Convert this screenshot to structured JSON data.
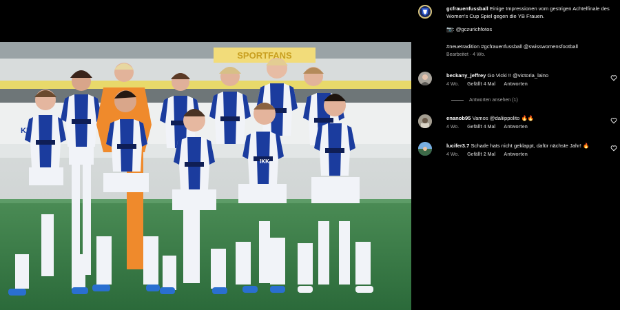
{
  "post": {
    "author": "gcfrauenfussball",
    "caption": "Einige Impressionen vom gestrigen Achtelfinale des Women's Cup Spiel gegen die YB Frauen.",
    "photo_credit_emoji": "📷",
    "photo_credit": ": @gczurichfotos",
    "hashtags": "#neuetradition #gcfrauenfussball @swisswomensfootball",
    "edited_label": "Bearbeitet · 4 Wo.",
    "photo_text": {
      "stadium_banner": "SPORTFANS",
      "jersey_sponsor": "IKK",
      "left_board": "KPMG"
    }
  },
  "comments": [
    {
      "user": "beckany_jeffrey",
      "text": "Go Vicki !! @victoria_laino",
      "age": "4 Wo.",
      "likes": "Gefällt 4 Mal",
      "reply": "Antworten",
      "view_replies": "Antworten ansehen (1)"
    },
    {
      "user": "enanob95",
      "text": "Vamos @daliippolito 🔥🔥",
      "age": "4 Wo.",
      "likes": "Gefällt 4 Mal",
      "reply": "Antworten"
    },
    {
      "user": "lucifer3.7",
      "text": "Schade hats nicht geklappt, dafür nächste Jahr! 🔥",
      "age": "4 Wo.",
      "likes": "Gefällt 2 Mal",
      "reply": "Antworten"
    }
  ],
  "icons": {
    "heart": "heart-outline-icon",
    "avatar_post": "gc-crest-icon"
  },
  "colors": {
    "background": "#000000",
    "text": "#f5f5f5",
    "muted": "#a8a8a8",
    "kit_blue": "#1b3c9e",
    "kit_white": "#f1f3f8",
    "keeper_orange": "#ef8a2c",
    "pitch": "#2f7a42"
  }
}
